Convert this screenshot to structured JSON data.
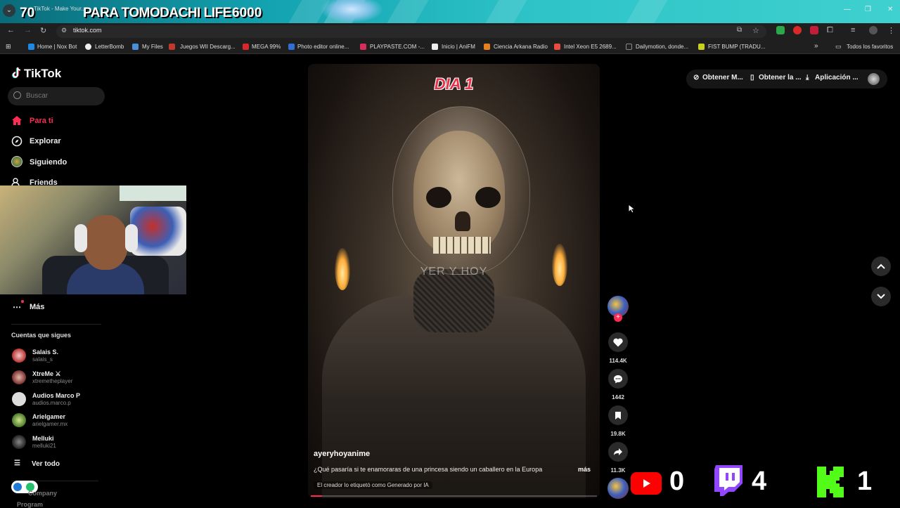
{
  "stream_overlay": {
    "count": "70",
    "title": "PARA TOMODACHI LIFE",
    "score": "6000",
    "youtube_count": "0",
    "twitch_count": "4",
    "kick_count": "1",
    "colors": {
      "youtube": "#ff0000",
      "twitch": "#9146ff",
      "kick": "#53fc18"
    }
  },
  "browser": {
    "tab_title": "TikTok - Make Your...",
    "url": "tiktok.com",
    "bookmarks": [
      {
        "label": "Home | Nox Bot"
      },
      {
        "label": "LetterBomb"
      },
      {
        "label": "My Files"
      },
      {
        "label": "Juegos WII Descarg..."
      },
      {
        "label": "MEGA 99%"
      },
      {
        "label": "Photo editor online..."
      },
      {
        "label": "PLAYPASTE.COM -..."
      },
      {
        "label": "Inicio | AniFM"
      },
      {
        "label": "Ciencia Arkana Radio"
      },
      {
        "label": "Intel Xeon E5 2689..."
      },
      {
        "label": "Dailymotion, donde..."
      },
      {
        "label": "FIST BUMP (TRADU..."
      }
    ],
    "all_bookmarks": "Todos los favoritos"
  },
  "tiktok": {
    "logo": "TikTok",
    "search_placeholder": "Buscar",
    "nav": {
      "for_you": "Para ti",
      "explore": "Explorar",
      "following": "Siguiendo",
      "friends": "Friends",
      "more": "Más"
    },
    "followed_title": "Cuentas que sigues",
    "accounts": [
      {
        "name": "Salais S.",
        "handle": "salais_s"
      },
      {
        "name": "XtreMe ⚔",
        "handle": "xtremetheplayer"
      },
      {
        "name": "Audios Marco P",
        "handle": "audios.marco.p"
      },
      {
        "name": "Arielgamer",
        "handle": "arielgamer.mx"
      },
      {
        "name": "Melluki",
        "handle": "melluki21"
      }
    ],
    "see_all": "Ver todo",
    "footer_company": "Company",
    "footer_program": "Program",
    "top_right": {
      "coins": "Obtener M...",
      "get_app": "Obtener la ...",
      "desktop_app": "Aplicación ..."
    },
    "accent": "#fe2c55",
    "video": {
      "overlay_text": "DIA 1",
      "watermark": "YER Y HOY",
      "author": "ayeryhoyanime",
      "description": "¿Qué pasaría si te enamoraras de una princesa siendo un caballero en la Europa",
      "more": "más",
      "ai_label": "El creador lo etiquetó como Generado por IA",
      "progress": 0.04
    },
    "actions": {
      "likes": "114.4K",
      "comments": "1442",
      "saves": "19.8K",
      "shares": "11.3K"
    }
  }
}
